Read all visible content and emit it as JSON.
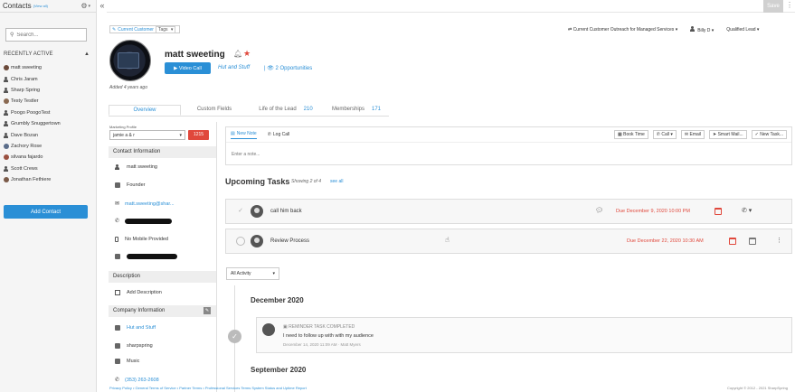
{
  "sidebar": {
    "title": "Contacts",
    "view_all": "(View all)",
    "search_placeholder": "Search...",
    "recent_label": "RECENTLY ACTIVE",
    "contacts": [
      {
        "name": "matt sweeting",
        "avatar": "photo"
      },
      {
        "name": "Chris Jaram",
        "avatar": "person"
      },
      {
        "name": "Sharp Spring",
        "avatar": "person"
      },
      {
        "name": "Testy Testler",
        "avatar": "photo"
      },
      {
        "name": "Poogo PoogoTest",
        "avatar": "person"
      },
      {
        "name": "Grumbly Snuggertown",
        "avatar": "person"
      },
      {
        "name": "Dave Bozan",
        "avatar": "person"
      },
      {
        "name": "Zachory Rose",
        "avatar": "photo"
      },
      {
        "name": "silvana fajardo",
        "avatar": "photo"
      },
      {
        "name": "Scott Crews",
        "avatar": "person"
      },
      {
        "name": "Jonathan Fethiere",
        "avatar": "photo"
      }
    ],
    "add_contact_label": "Add Contact"
  },
  "topbar": {
    "save_label": "Save"
  },
  "header": {
    "current_customer_label": "Current Customer",
    "tags_label": "Tags",
    "contact_name": "matt sweeting",
    "video_call_label": "Video Call",
    "company_link": "Hut and Stuff",
    "opportunities_link": "2 Opportunities",
    "added_ago": "Added 4 years ago",
    "pipeline": "Current Customer Outreach for Managed Services",
    "owner": "Billy D",
    "lead_status": "Qualified Lead"
  },
  "tabs": [
    {
      "label": "Overview",
      "count": ""
    },
    {
      "label": "Custom Fields",
      "count": ""
    },
    {
      "label": "Life of the Lead",
      "count": "210"
    },
    {
      "label": "Memberships",
      "count": "171"
    }
  ],
  "info": {
    "marketing_profile_label": "Marketing Profile",
    "marketing_profile_value": "jamie a & r",
    "lead_score": "1215",
    "contact_info_heading": "Contact Information",
    "full_name": "matt sweeting",
    "title": "Founder",
    "email": "matt.sweeting@shar...",
    "mobile_label": "No Mobile Provided",
    "description_heading": "Description",
    "add_description": "Add Description",
    "company_info_heading": "Company Information",
    "company_name": "Hut and Stuff",
    "company_website": "sharpspring",
    "industry": "Music",
    "company_phone": "(353) 263-2608"
  },
  "notes": {
    "new_note_label": "New Note",
    "log_call_label": "Log Call",
    "actions": [
      "Book Time",
      "Call",
      "Email",
      "Smart Mail...",
      "New Task..."
    ],
    "input_placeholder": "Enter a note..."
  },
  "upcoming": {
    "title": "Upcoming Tasks",
    "count_text": "Showing 2 of 4",
    "see_all": "see all",
    "tasks": [
      {
        "name": "call him back",
        "due": "Due December 9, 2020 10:00 PM"
      },
      {
        "name": "Review Process",
        "due": "Due December 22, 2020 10:30 AM"
      }
    ]
  },
  "activity": {
    "filter_label": "All Activity",
    "month_1": "December 2020",
    "card_type": "REMINDER TASK COMPLETED",
    "card_body": "I need to follow up with with my audience",
    "card_meta": "December 14, 2020 11:09 AM  ·  Matt Myers",
    "month_2": "September 2020"
  },
  "footer": {
    "links": "Privacy Policy • General Terms of Service • Partner Terms • Professional Services Terms System Status and Uptime Report",
    "copyright": "Copyright © 2012 - 2021 SharpSpring"
  },
  "colors": {
    "accent": "#2a8fd6",
    "danger": "#e0483c"
  }
}
